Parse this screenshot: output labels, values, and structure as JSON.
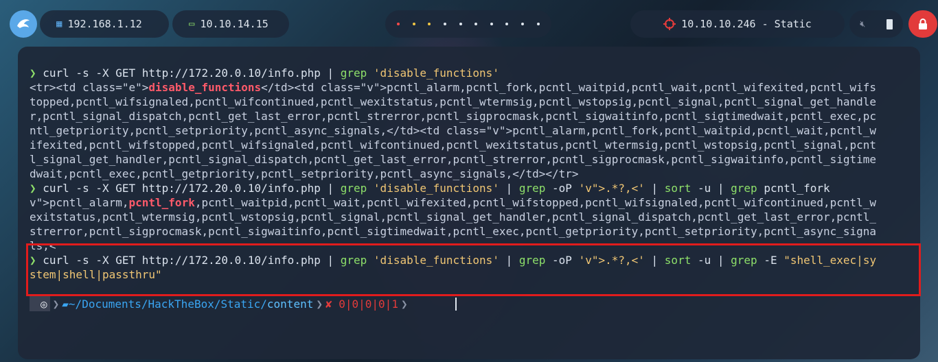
{
  "topbar": {
    "ip_local": "192.168.1.12",
    "ip_vpn": "10.10.14.15",
    "target": "10.10.10.246 - Static",
    "workspace_dots": 10
  },
  "terminal": {
    "lines": [
      [
        {
          "t": "❯ ",
          "c": "pr"
        },
        {
          "t": "curl -s -X GET http://172.20.0.10/info.php | ",
          "c": "cmd"
        },
        {
          "t": "grep ",
          "c": "kw"
        },
        {
          "t": "'disable_functions'",
          "c": "str"
        }
      ],
      [
        {
          "t": "<tr><td class=\"e\">",
          "c": ""
        },
        {
          "t": "disable_functions",
          "c": "hl"
        },
        {
          "t": "</td><td class=\"v\">pcntl_alarm,pcntl_fork,pcntl_waitpid,pcntl_wait,pcntl_wifexited,pcntl_wifs",
          "c": ""
        }
      ],
      [
        {
          "t": "topped,pcntl_wifsignaled,pcntl_wifcontinued,pcntl_wexitstatus,pcntl_wtermsig,pcntl_wstopsig,pcntl_signal,pcntl_signal_get_handle",
          "c": ""
        }
      ],
      [
        {
          "t": "r,pcntl_signal_dispatch,pcntl_get_last_error,pcntl_strerror,pcntl_sigprocmask,pcntl_sigwaitinfo,pcntl_sigtimedwait,pcntl_exec,pc",
          "c": ""
        }
      ],
      [
        {
          "t": "ntl_getpriority,pcntl_setpriority,pcntl_async_signals,</td><td class=\"v\">pcntl_alarm,pcntl_fork,pcntl_waitpid,pcntl_wait,pcntl_w",
          "c": ""
        }
      ],
      [
        {
          "t": "ifexited,pcntl_wifstopped,pcntl_wifsignaled,pcntl_wifcontinued,pcntl_wexitstatus,pcntl_wtermsig,pcntl_wstopsig,pcntl_signal,pcnt",
          "c": ""
        }
      ],
      [
        {
          "t": "l_signal_get_handler,pcntl_signal_dispatch,pcntl_get_last_error,pcntl_strerror,pcntl_sigprocmask,pcntl_sigwaitinfo,pcntl_sigtime",
          "c": ""
        }
      ],
      [
        {
          "t": "dwait,pcntl_exec,pcntl_getpriority,pcntl_setpriority,pcntl_async_signals,</td></tr>",
          "c": ""
        }
      ],
      [
        {
          "t": "❯ ",
          "c": "pr"
        },
        {
          "t": "curl -s -X GET http://172.20.0.10/info.php | ",
          "c": "cmd"
        },
        {
          "t": "grep ",
          "c": "kw"
        },
        {
          "t": "'disable_functions'",
          "c": "str"
        },
        {
          "t": " | ",
          "c": "cmd"
        },
        {
          "t": "grep ",
          "c": "kw"
        },
        {
          "t": "-oP ",
          "c": "cmd"
        },
        {
          "t": "'v\">.*?,<'",
          "c": "str"
        },
        {
          "t": " | ",
          "c": "cmd"
        },
        {
          "t": "sort ",
          "c": "kw"
        },
        {
          "t": "-u | ",
          "c": "cmd"
        },
        {
          "t": "grep ",
          "c": "kw"
        },
        {
          "t": "pcntl_fork",
          "c": "cmd"
        }
      ],
      [
        {
          "t": "v\">pcntl_alarm,",
          "c": ""
        },
        {
          "t": "pcntl_fork",
          "c": "hl"
        },
        {
          "t": ",pcntl_waitpid,pcntl_wait,pcntl_wifexited,pcntl_wifstopped,pcntl_wifsignaled,pcntl_wifcontinued,pcntl_w",
          "c": ""
        }
      ],
      [
        {
          "t": "exitstatus,pcntl_wtermsig,pcntl_wstopsig,pcntl_signal,pcntl_signal_get_handler,pcntl_signal_dispatch,pcntl_get_last_error,pcntl_",
          "c": ""
        }
      ],
      [
        {
          "t": "strerror,pcntl_sigprocmask,pcntl_sigwaitinfo,pcntl_sigtimedwait,pcntl_exec,pcntl_getpriority,pcntl_setpriority,pcntl_async_signa",
          "c": ""
        }
      ],
      [
        {
          "t": "ls,<",
          "c": ""
        }
      ],
      [
        {
          "t": "❯ ",
          "c": "pr"
        },
        {
          "t": "curl -s -X GET http://172.20.0.10/info.php | ",
          "c": "cmd"
        },
        {
          "t": "grep ",
          "c": "kw"
        },
        {
          "t": "'disable_functions'",
          "c": "str"
        },
        {
          "t": " | ",
          "c": "cmd"
        },
        {
          "t": "grep ",
          "c": "kw"
        },
        {
          "t": "-oP ",
          "c": "cmd"
        },
        {
          "t": "'v\">.*?,<'",
          "c": "str"
        },
        {
          "t": " | ",
          "c": "cmd"
        },
        {
          "t": "sort ",
          "c": "kw"
        },
        {
          "t": "-u | ",
          "c": "cmd"
        },
        {
          "t": "grep ",
          "c": "kw"
        },
        {
          "t": "-E ",
          "c": "cmd"
        },
        {
          "t": "\"shell_exec|sy",
          "c": "str"
        }
      ],
      [
        {
          "t": "stem|shell|passthru\"",
          "c": "str"
        }
      ]
    ],
    "prompt": {
      "home": "~/Documents/HackTheBox/Static/",
      "dir": "content",
      "status": "✘ 0|0|0|0|1"
    }
  },
  "colors": {
    "accent": "#8ee06a",
    "highlight": "#e11c1c",
    "path": "#3aa5f2",
    "error": "#e33b3b"
  }
}
